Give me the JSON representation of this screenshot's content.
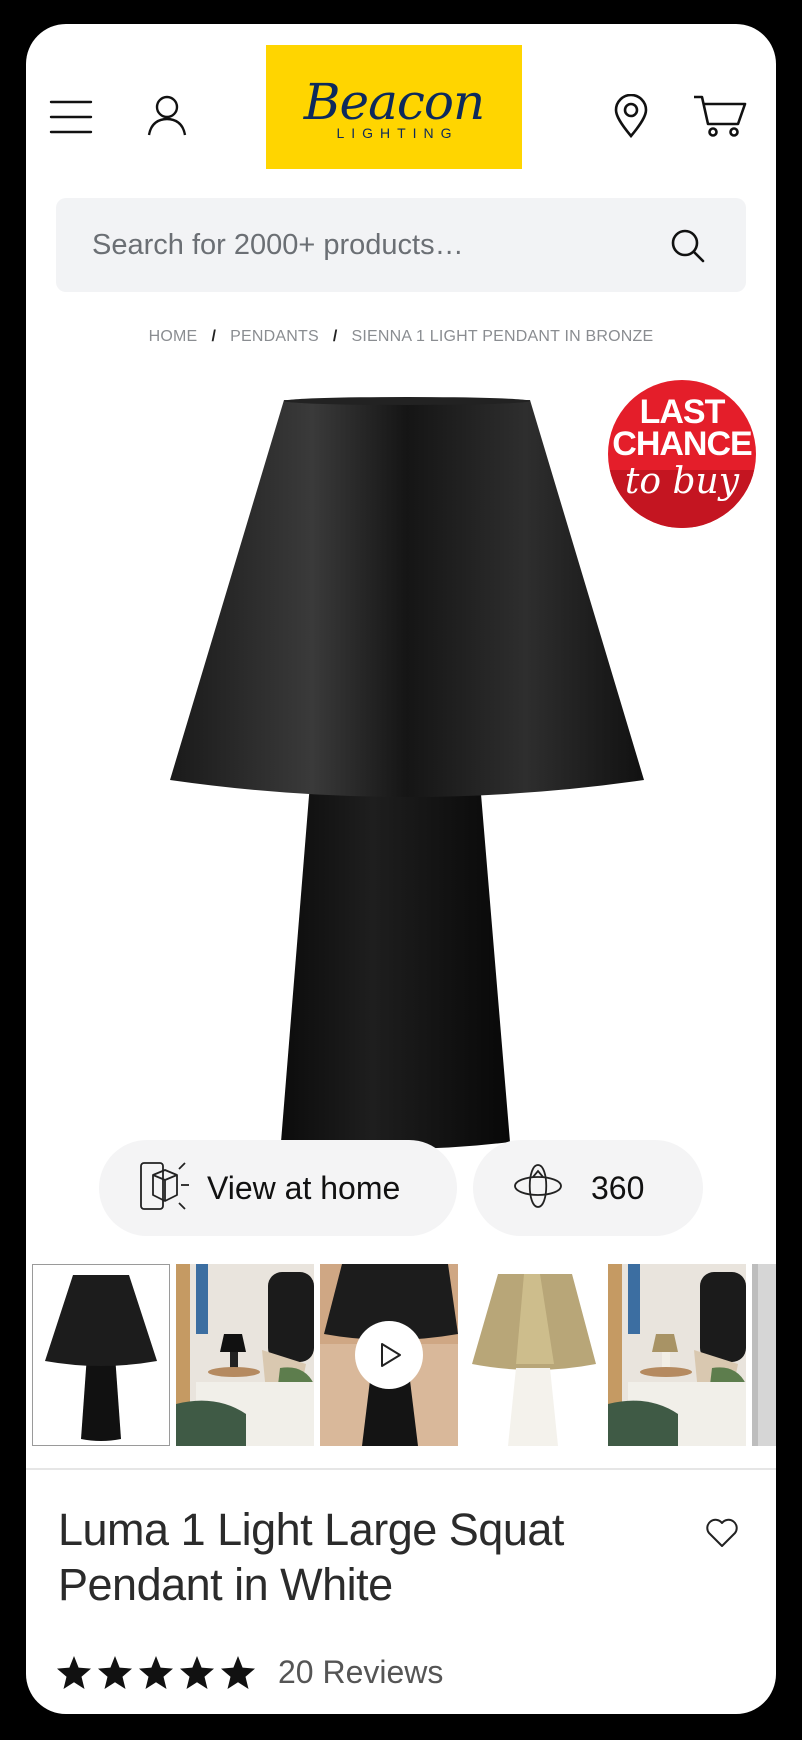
{
  "header": {
    "logo_text": "Beacon",
    "logo_subtext": "LIGHTING",
    "brand_color": "#FFD500",
    "brand_text_color": "#0d2a5c",
    "icons": [
      "menu-icon",
      "user-icon",
      "location-pin-icon",
      "cart-icon"
    ]
  },
  "search": {
    "placeholder": "Search for 2000+ products…",
    "value": ""
  },
  "breadcrumb": {
    "items": [
      "HOME",
      "PENDANTS",
      "SIENNA 1 LIGHT PENDANT IN BRONZE"
    ],
    "separator": "/"
  },
  "badge": {
    "line1": "LAST",
    "line2": "CHANCE",
    "line3": "to buy",
    "color": "#e41e2a"
  },
  "view_buttons": {
    "ar_label": "View at home",
    "rotate_label": "360"
  },
  "thumbnails": [
    {
      "alt": "black lamp product",
      "selected": true
    },
    {
      "alt": "bedroom scene"
    },
    {
      "alt": "video",
      "has_play": true
    },
    {
      "alt": "brass and white lamp"
    },
    {
      "alt": "bedroom scene brass lamp"
    },
    {
      "alt": "partial"
    }
  ],
  "product": {
    "title": "Luma 1 Light Large Squat Pendant in White",
    "rating": 5,
    "reviews_label": "20 Reviews"
  }
}
